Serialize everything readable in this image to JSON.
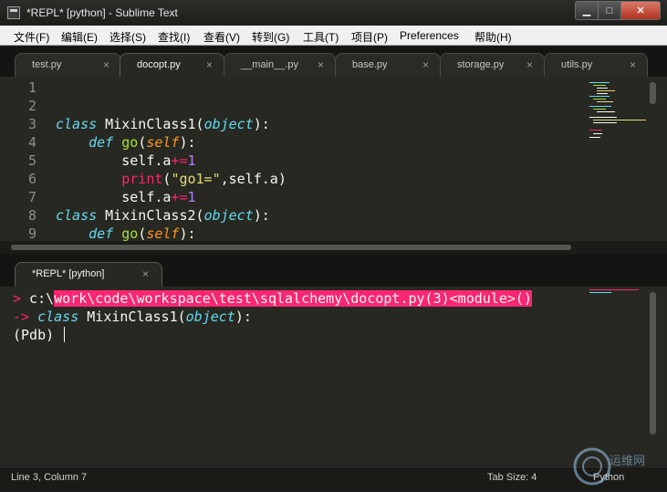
{
  "window": {
    "title": "*REPL* [python] - Sublime Text",
    "controls": {
      "minimize": "▁",
      "maximize": "□",
      "close": "✕"
    }
  },
  "menu": [
    "文件(F)",
    "编辑(E)",
    "选择(S)",
    "查找(I)",
    "查看(V)",
    "转到(G)",
    "工具(T)",
    "项目(P)",
    "Preferences",
    "帮助(H)"
  ],
  "editor_tabs": [
    {
      "label": "test.py",
      "close": "×",
      "active": false
    },
    {
      "label": "docopt.py",
      "close": "×",
      "active": true
    },
    {
      "label": "__main__.py",
      "close": "×",
      "active": false
    },
    {
      "label": "base.py",
      "close": "×",
      "active": false
    },
    {
      "label": "storage.py",
      "close": "×",
      "active": false
    },
    {
      "label": "utils.py",
      "close": "×",
      "active": false
    }
  ],
  "editor": {
    "line_numbers": [
      "1",
      "2",
      "3",
      "4",
      "5",
      "6",
      "7",
      "8",
      "9"
    ],
    "code": {
      "l3_kw": "class",
      "l3_name": " MixinClass1(",
      "l3_base": "object",
      "l3_end": "):",
      "l4_indent": "    ",
      "l4_kw": "def",
      "l4_sp": " ",
      "l4_fn": "go",
      "l4_open": "(",
      "l4_param": "self",
      "l4_close": "):",
      "l5_indent": "        ",
      "l5_text": "self.a",
      "l5_op": "+=",
      "l5_num": "1",
      "l6_indent": "        ",
      "l6_fn": "print",
      "l6_open": "(",
      "l6_str": "\"go1=\"",
      "l6_rest": ",self.a)",
      "l7_indent": "        ",
      "l7_text": "self.a",
      "l7_op": "+=",
      "l7_num": "1",
      "l8_kw": "class",
      "l8_name": " MixinClass2(",
      "l8_base": "object",
      "l8_end": "):",
      "l9_indent": "    ",
      "l9_kw": "def",
      "l9_sp": " ",
      "l9_fn": "go",
      "l9_open": "(",
      "l9_param": "self",
      "l9_close": "):"
    }
  },
  "repl_tab": {
    "label": "*REPL* [python]",
    "close": "×"
  },
  "repl": {
    "line1_arrow": ">",
    "line1_prefix": " c:\\",
    "line1_path": "work\\code\\workspace\\test\\sqlalchemy\\docopt.py(3)<module>()",
    "line2_arrow": "->",
    "line2_kw": "class",
    "line2_name": " MixinClass1(",
    "line2_base": "object",
    "line2_end": "):",
    "line3_prompt": "(Pdb) "
  },
  "status": {
    "position": "Line 3, Column 7",
    "tab_size": "Tab Size: 4",
    "syntax": "Python"
  },
  "watermark": {
    "text": "运维网"
  },
  "colors": {
    "background": "#272822",
    "keyword": "#66d9ef",
    "function": "#a6e22e",
    "parameter": "#fd971f",
    "operator": "#f92672",
    "number": "#ae81ff",
    "string": "#e6db74",
    "highlight": "#f92672"
  }
}
